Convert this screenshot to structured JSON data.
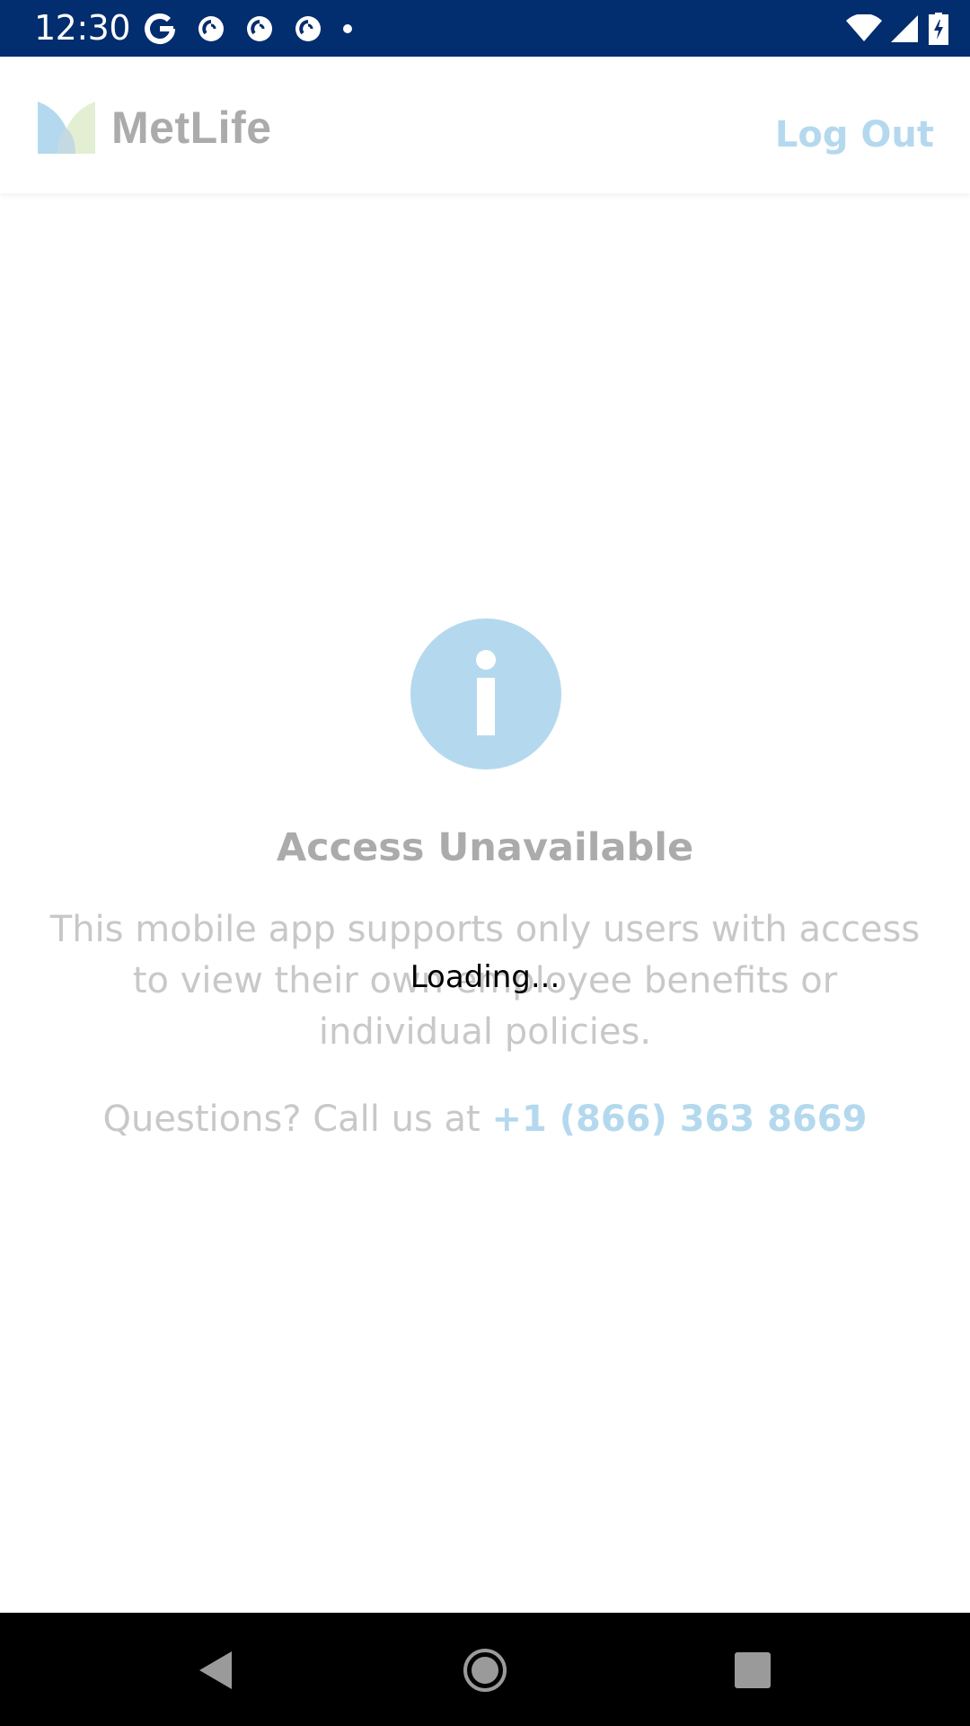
{
  "status_bar": {
    "time": "12:30",
    "notification_icons": [
      "google-icon",
      "pocket-casts-icon",
      "pocket-casts-icon",
      "pocket-casts-icon",
      "more-dot-icon"
    ],
    "system_icons": [
      "wifi-icon",
      "cell-signal-icon",
      "battery-charging-icon"
    ]
  },
  "header": {
    "logo_text": "MetLife",
    "logout_label": "Log Out"
  },
  "content": {
    "icon": "info-icon",
    "title": "Access Unavailable",
    "message": "This mobile app supports only users with access to view their own employee benefits or individual policies.",
    "questions_prefix": "Questions? Call us at",
    "phone": "+1 (866) 363 8669"
  },
  "overlay": {
    "loading_text": "Loading..."
  },
  "colors": {
    "status_bar": "#022D6E",
    "accent_link": "#B4D9EE",
    "muted_text": "#ABABAB"
  },
  "nav_bar": {
    "buttons": [
      "back-icon",
      "home-icon",
      "recents-icon"
    ]
  }
}
